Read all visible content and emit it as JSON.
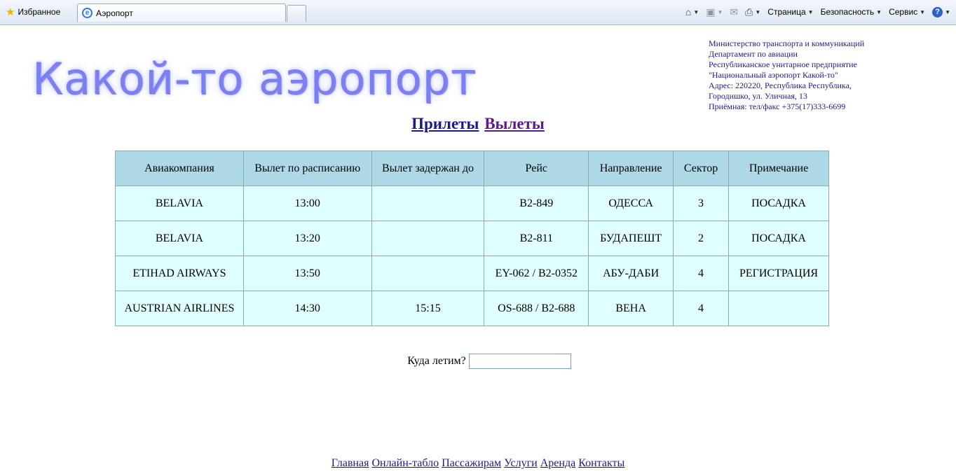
{
  "browser": {
    "favorites_label": "Избранное",
    "tab_title": "Аэропорт",
    "menu_page": "Страница",
    "menu_security": "Безопасность",
    "menu_tools": "Сервис",
    "icons": [
      "home-icon",
      "rss-icon",
      "mail-icon",
      "print-icon",
      "help-icon"
    ]
  },
  "header": {
    "logo_text": "Какой-то аэропорт",
    "info_lines": [
      "Министерство транспорта и коммуникаций",
      "Департамент по авиации",
      "Республиканское унитарное предприятие",
      "\"Национальный аэропорт Какой-то\"",
      "Адрес: 220220, Республика Республика,",
      "Городишко, ул. Уличная, 13",
      "Приёмная: тел/факс +375(17)333-6699"
    ]
  },
  "nav": {
    "arrivals": "Прилеты",
    "departures": "Вылеты"
  },
  "table": {
    "headers": [
      "Авиакомпания",
      "Вылет по расписанию",
      "Вылет задержан до",
      "Рейс",
      "Направление",
      "Сектор",
      "Примечание"
    ],
    "rows": [
      [
        "BELAVIA",
        "13:00",
        "",
        "B2-849",
        "ОДЕССА",
        "3",
        "ПОСАДКА"
      ],
      [
        "BELAVIA",
        "13:20",
        "",
        "B2-811",
        "БУДАПЕШТ",
        "2",
        "ПОСАДКА"
      ],
      [
        "ETIHAD AIRWAYS",
        "13:50",
        "",
        "EY-062 / B2-0352",
        "АБУ-ДАБИ",
        "4",
        "РЕГИСТРАЦИЯ"
      ],
      [
        "AUSTRIAN AIRLINES",
        "14:30",
        "15:15",
        "OS-688 / B2-688",
        "ВЕНА",
        "4",
        ""
      ]
    ]
  },
  "search": {
    "label": "Куда летим?",
    "value": ""
  },
  "footer": {
    "links": [
      "Главная",
      "Онлайн-табло",
      "Пассажирам",
      "Услуги",
      "Аренда",
      "Контакты"
    ]
  },
  "colors": {
    "header_bg": "#add8e6",
    "cell_bg": "#e0ffff",
    "logo": "#7b7ff0",
    "link": "#1a1a8c",
    "visited_link": "#5a1a8c"
  }
}
